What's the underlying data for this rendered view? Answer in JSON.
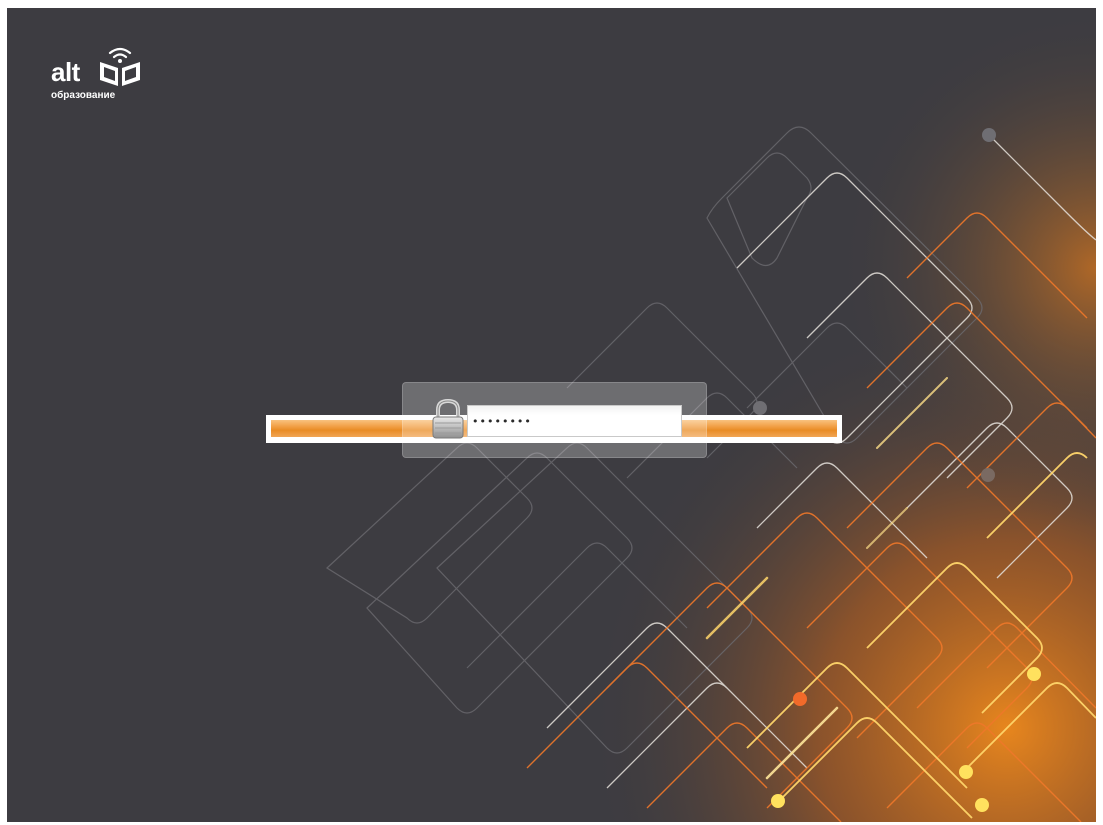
{
  "brand": {
    "logo_word": "alt",
    "logo_subtitle": "образование"
  },
  "login": {
    "password_value": "••••••••",
    "lock_icon": "padlock-icon"
  },
  "progress": {
    "fraction": 1.0,
    "color": "#ef9a3c"
  },
  "theme": {
    "background": "#3d3c41",
    "accent": "#f08a1c"
  }
}
